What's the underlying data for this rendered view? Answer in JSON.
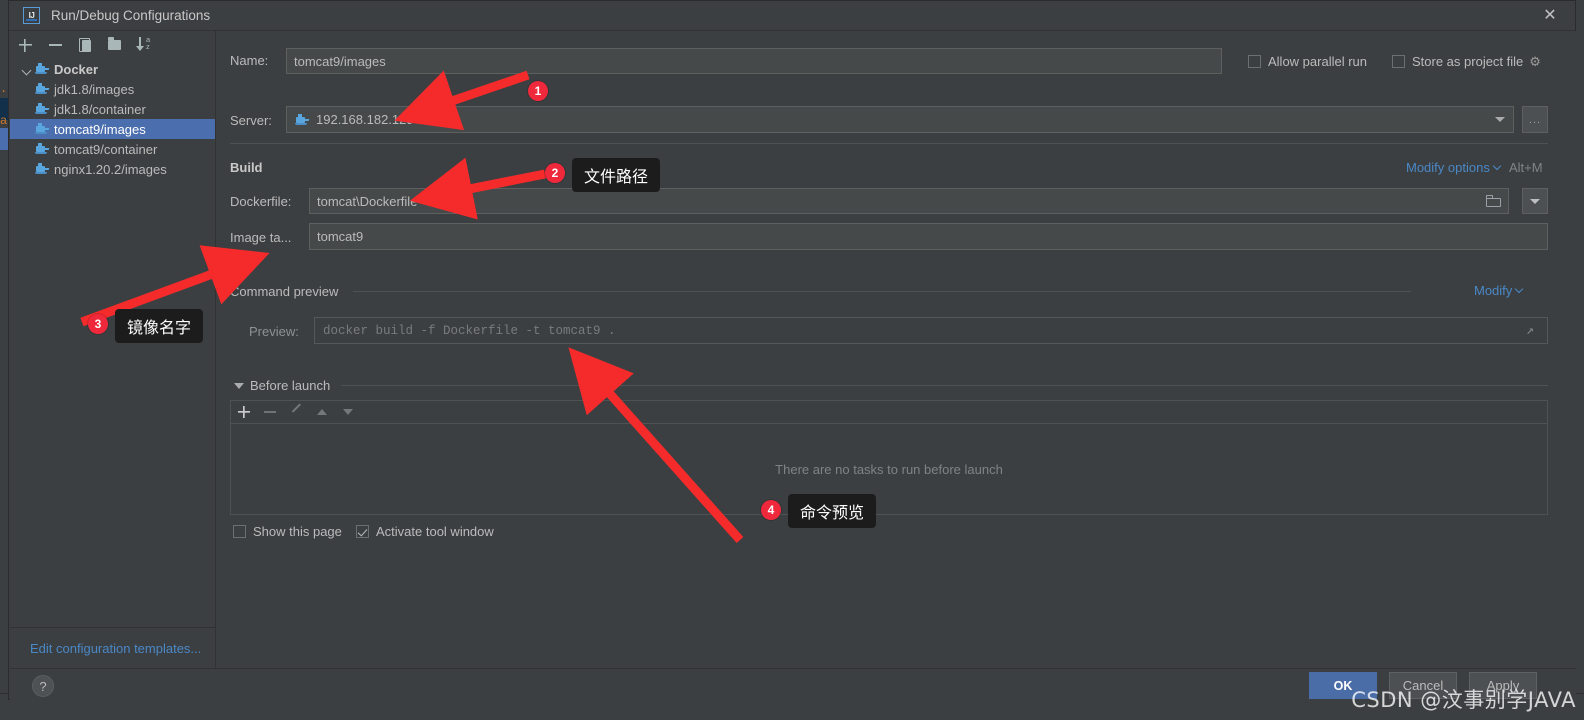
{
  "window": {
    "title": "Run/Debug Configurations",
    "logo_text": "IJ",
    "close_icon": "close-icon"
  },
  "left_toolbar": {
    "buttons": [
      {
        "name": "add-configuration-button",
        "icon": "plus-icon"
      },
      {
        "name": "remove-configuration-button",
        "icon": "minus-icon"
      },
      {
        "name": "copy-configuration-button",
        "icon": "copy-icon"
      },
      {
        "name": "new-folder-button",
        "icon": "folder-add-icon"
      },
      {
        "name": "sort-configurations-button",
        "icon": "sort-az-icon"
      }
    ]
  },
  "tree": {
    "root": {
      "label": "Docker",
      "icon": "docker-icon"
    },
    "items": [
      {
        "label": "jdk1.8/images",
        "selected": false
      },
      {
        "label": "jdk1.8/container",
        "selected": false
      },
      {
        "label": "tomcat9/images",
        "selected": true
      },
      {
        "label": "tomcat9/container",
        "selected": false
      },
      {
        "label": "nginx1.20.2/images",
        "selected": false
      }
    ],
    "footer_link": "Edit configuration templates..."
  },
  "form": {
    "name_label": "Name:",
    "name_value": "tomcat9/images",
    "allow_parallel_run": {
      "label": "Allow parallel run",
      "checked": false
    },
    "store_as_project_file": {
      "label": "Store as project file",
      "checked": false,
      "gear_icon": "gear-icon"
    },
    "server_label": "Server:",
    "server_value": "192.168.182.129",
    "server_icon": "docker-icon",
    "server_browse_button": "...",
    "build_section": "Build",
    "modify_options_link": "Modify options",
    "modify_options_shortcut": "Alt+M",
    "dockerfile_label": "Dockerfile:",
    "dockerfile_value": "tomcat\\Dockerfile",
    "dockerfile_browse_icon": "folder-icon",
    "dockerfile_dropdown_icon": "chevron-down-icon",
    "image_tag_label": "Image ta...",
    "image_tag_value": "tomcat9",
    "command_preview_section": "Command preview",
    "modify_link": "Modify",
    "preview_label": "Preview:",
    "preview_value": "docker build -f Dockerfile -t tomcat9 .",
    "preview_expand_icon": "expand-icon"
  },
  "before_launch": {
    "title": "Before launch",
    "collapse_icon": "triangle-down-icon",
    "toolbar": [
      {
        "name": "add-task-button",
        "icon": "plus-icon"
      },
      {
        "name": "remove-task-button",
        "icon": "minus-icon"
      },
      {
        "name": "edit-task-button",
        "icon": "pencil-icon"
      },
      {
        "name": "move-task-up-button",
        "icon": "arrow-up-icon"
      },
      {
        "name": "move-task-down-button",
        "icon": "arrow-down-icon"
      }
    ],
    "empty_text": "There are no tasks to run before launch",
    "show_this_page": {
      "label": "Show this page",
      "checked": false
    },
    "activate_tool_window": {
      "label": "Activate tool window",
      "checked": true
    }
  },
  "footer": {
    "help_icon": "?",
    "ok": "OK",
    "cancel": "Cancel",
    "apply": "Apply"
  },
  "annotations": [
    {
      "number": "1",
      "text": ""
    },
    {
      "number": "2",
      "text": "文件路径"
    },
    {
      "number": "3",
      "text": "镜像名字"
    },
    {
      "number": "4",
      "text": "命令预览"
    }
  ],
  "background": {
    "fragment_1": ".t",
    "fragment_2": "ar"
  },
  "watermark": "CSDN @汶事别学JAVA",
  "colors": {
    "accent_blue": "#4b6eaf",
    "link_blue": "#4a88c7",
    "annotation_red": "#f0283c",
    "panel_bg": "#3c3f41",
    "input_bg": "#45494a",
    "docker_icon": "#59a5dd"
  }
}
